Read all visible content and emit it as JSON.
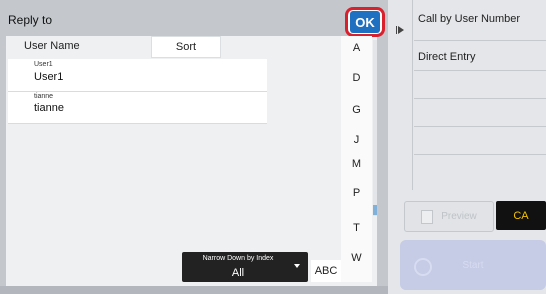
{
  "dialog": {
    "title": "Reply to",
    "ok_label": "OK",
    "column_header": "User Name",
    "sort_label": "Sort",
    "users": [
      {
        "small": "User1",
        "main": "User1"
      },
      {
        "small": "tianne",
        "main": "tianne"
      }
    ],
    "index_letters": [
      "A",
      "D",
      "G",
      "J",
      "M",
      "P",
      "T",
      "W"
    ],
    "narrow_down": {
      "label": "Narrow Down by Index",
      "value": "All"
    },
    "abc_label": "ABC"
  },
  "background": {
    "menu": [
      "Call by User Number",
      "Direct Entry"
    ],
    "preview_label": "Preview",
    "ca_label": "CA",
    "start_label": "Start"
  },
  "colors": {
    "ok_button": "#1f70c1",
    "ok_highlight": "#d9212e",
    "ca_text": "#f5c400"
  }
}
